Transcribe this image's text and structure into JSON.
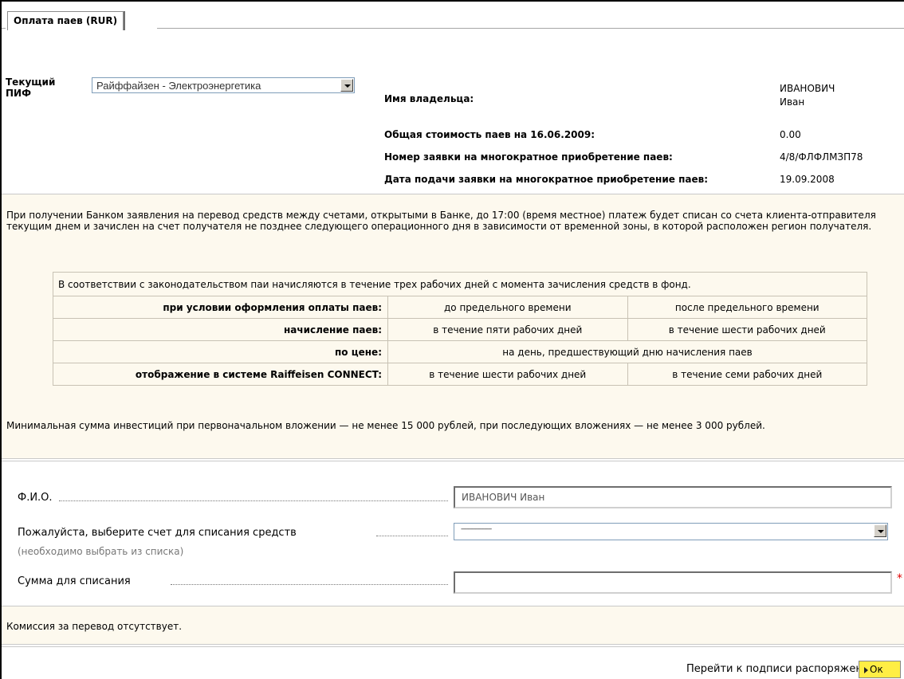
{
  "tab": {
    "label": "Оплата паев (RUR)"
  },
  "fund": {
    "label_line1": "Текущий",
    "label_line2": "ПИФ",
    "selected": "Райффайзен - Электроэнергетика"
  },
  "owner": {
    "label": "Имя владельца:",
    "value_line1": "ИВАНОВИЧ",
    "value_line2": "Иван"
  },
  "info": {
    "total_label": "Общая стоимость паев на 16.06.2009:",
    "total_value": "0.00",
    "order_no_label": "Номер заявки на многократное приобретение паев:",
    "order_no_value": "4/8/ФЛФЛМЗП78",
    "order_date_label": "Дата подачи заявки на многократное приобретение паев:",
    "order_date_value": "19.09.2008"
  },
  "notice": "При получении Банком заявления на перевод средств между счетами, открытыми в Банке, до 17:00 (время местное) платеж будет списан со счета клиента-отправителя текущим днем и зачислен на счет получателя не позднее следующего операционного дня в зависимости от временной зоны, в которой расположен регион получателя.",
  "terms": {
    "intro": "В соответствии с законодательством паи начисляются в течение трех рабочих дней с момента зачисления средств в фонд.",
    "rows": [
      {
        "label": "при условии оформления оплаты паев:",
        "a": "до предельного времени",
        "b": "после предельного времени"
      },
      {
        "label": "начисление паев:",
        "a": "в течение пяти рабочих дней",
        "b": "в течение шести рабочих дней"
      },
      {
        "label": "по цене:",
        "merged": "на день, предшествующий дню начисления паев"
      },
      {
        "label": "отображение в системе Raiffeisen CONNECT:",
        "a": "в течение шести рабочих дней",
        "b": "в течение семи рабочих дней"
      }
    ]
  },
  "min_sum": "Минимальная сумма инвестиций при первоначальном вложении — не менее 15 000 рублей, при последующих вложениях — не менее 3 000 рублей.",
  "form": {
    "fio_label": "Ф.И.О.",
    "fio_value": "ИВАНОВИЧ Иван",
    "account_label": "Пожалуйста, выберите счет для списания средств",
    "account_note": "(необходимо выбрать из списка)",
    "account_selected": "-----------------",
    "amount_label": "Сумма для списания",
    "amount_value": "",
    "required_mark": "*"
  },
  "commission": "Комиссия за перевод отсутствует.",
  "footer": {
    "sign_label": "Перейти к подписи распоряжения",
    "ok_label": "Ок"
  }
}
